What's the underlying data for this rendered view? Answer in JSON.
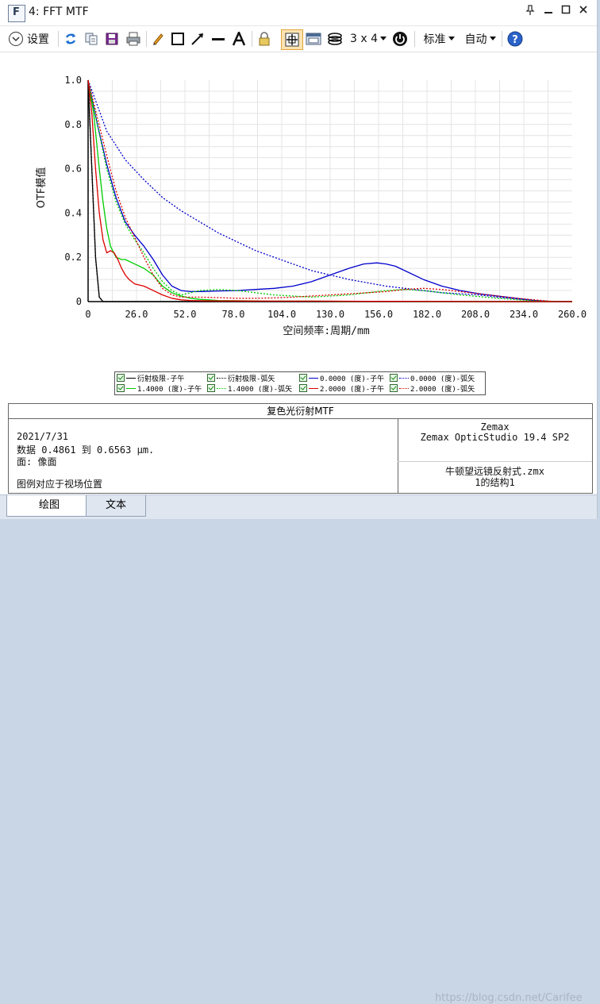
{
  "window": {
    "title": "4: FFT MTF",
    "icon_letter": "F"
  },
  "toolbar": {
    "settings_label": "设置",
    "grid_label": "3 x 4",
    "standard_label": "标准",
    "auto_label": "自动"
  },
  "chart_data": {
    "type": "line",
    "title": "",
    "xlabel": "空间频率:周期/mm",
    "ylabel": "OTF模值",
    "xlim": [
      0,
      260
    ],
    "ylim": [
      0,
      1.0
    ],
    "x_ticks": [
      "0",
      "26.0",
      "52.0",
      "78.0",
      "104.0",
      "130.0",
      "156.0",
      "182.0",
      "208.0",
      "234.0",
      "260.0"
    ],
    "y_ticks": [
      "0",
      "0.2",
      "0.4",
      "0.6",
      "0.8",
      "1.0"
    ],
    "grid": true,
    "series": [
      {
        "name": "衍射极限-子午",
        "color": "#000000",
        "dash": "solid",
        "x": [
          0,
          2,
          4,
          6,
          8,
          260
        ],
        "y": [
          1.0,
          0.6,
          0.2,
          0.02,
          0.0,
          0.0
        ]
      },
      {
        "name": "衍射极限-弧矢",
        "color": "#000000",
        "dash": "dotted",
        "x": [
          0,
          2,
          4,
          6,
          8,
          260
        ],
        "y": [
          1.0,
          0.6,
          0.2,
          0.02,
          0.0,
          0.0
        ]
      },
      {
        "name": "0.0000 (度)-子午",
        "color": "#0000cc",
        "dash": "solid",
        "x": [
          0,
          5,
          10,
          15,
          20,
          25,
          30,
          35,
          40,
          45,
          50,
          55,
          60,
          70,
          80,
          90,
          100,
          110,
          120,
          130,
          140,
          148,
          155,
          160,
          165,
          170,
          180,
          190,
          200,
          210,
          220,
          230,
          240,
          250,
          260
        ],
        "y": [
          1.0,
          0.8,
          0.62,
          0.47,
          0.36,
          0.3,
          0.25,
          0.19,
          0.12,
          0.07,
          0.05,
          0.045,
          0.045,
          0.048,
          0.05,
          0.055,
          0.06,
          0.07,
          0.09,
          0.12,
          0.15,
          0.17,
          0.175,
          0.17,
          0.16,
          0.14,
          0.1,
          0.07,
          0.05,
          0.035,
          0.025,
          0.015,
          0.005,
          0.0,
          0.0
        ]
      },
      {
        "name": "0.0000 (度)-弧矢",
        "color": "#0000cc",
        "dash": "dotted",
        "x": [
          0,
          10,
          20,
          30,
          40,
          50,
          60,
          70,
          80,
          90,
          100,
          110,
          120,
          130,
          140,
          150,
          160,
          170,
          180,
          190,
          200,
          210,
          220,
          230,
          240,
          250,
          260
        ],
        "y": [
          1.0,
          0.77,
          0.64,
          0.55,
          0.47,
          0.41,
          0.36,
          0.31,
          0.27,
          0.23,
          0.2,
          0.17,
          0.14,
          0.12,
          0.1,
          0.085,
          0.07,
          0.06,
          0.05,
          0.04,
          0.035,
          0.03,
          0.02,
          0.012,
          0.005,
          0.0,
          0.0
        ]
      },
      {
        "name": "1.4000 (度)-子午",
        "color": "#00cc00",
        "dash": "solid",
        "x": [
          0,
          3,
          6,
          8,
          10,
          12,
          15,
          18,
          20,
          25,
          30,
          35,
          40,
          45,
          50,
          55,
          60,
          70,
          80,
          90,
          100,
          110,
          120,
          140,
          160,
          180,
          200,
          220,
          240,
          260
        ],
        "y": [
          1.0,
          0.85,
          0.6,
          0.45,
          0.33,
          0.25,
          0.2,
          0.19,
          0.19,
          0.17,
          0.15,
          0.12,
          0.07,
          0.04,
          0.025,
          0.015,
          0.01,
          0.005,
          0.004,
          0.003,
          0.002,
          0.002,
          0.002,
          0.001,
          0.001,
          0.0,
          0.0,
          0.0,
          0.0,
          0.0
        ]
      },
      {
        "name": "1.4000 (度)-弧矢",
        "color": "#00cc00",
        "dash": "dotted",
        "x": [
          0,
          5,
          10,
          15,
          20,
          25,
          30,
          35,
          40,
          45,
          50,
          55,
          60,
          70,
          80,
          90,
          100,
          120,
          140,
          160,
          170,
          180,
          190,
          200,
          220,
          240,
          260
        ],
        "y": [
          1.0,
          0.8,
          0.6,
          0.45,
          0.35,
          0.28,
          0.22,
          0.15,
          0.09,
          0.05,
          0.03,
          0.04,
          0.05,
          0.055,
          0.05,
          0.04,
          0.03,
          0.02,
          0.03,
          0.05,
          0.055,
          0.05,
          0.04,
          0.03,
          0.015,
          0.003,
          0.0
        ]
      },
      {
        "name": "2.0000 (度)-子午",
        "color": "#dd0000",
        "dash": "solid",
        "x": [
          0,
          2,
          4,
          6,
          8,
          10,
          12,
          14,
          16,
          18,
          20,
          22,
          25,
          30,
          35,
          40,
          45,
          50,
          55,
          60,
          70,
          80,
          100,
          120,
          150,
          180,
          210,
          240,
          260
        ],
        "y": [
          1.0,
          0.85,
          0.6,
          0.4,
          0.28,
          0.22,
          0.23,
          0.22,
          0.19,
          0.15,
          0.12,
          0.1,
          0.08,
          0.07,
          0.05,
          0.03,
          0.015,
          0.008,
          0.005,
          0.004,
          0.003,
          0.003,
          0.002,
          0.002,
          0.001,
          0.001,
          0.0,
          0.0,
          0.0
        ]
      },
      {
        "name": "2.0000 (度)-弧矢",
        "color": "#dd0000",
        "dash": "dotted",
        "x": [
          0,
          5,
          10,
          15,
          20,
          25,
          30,
          35,
          40,
          45,
          50,
          55,
          60,
          70,
          80,
          90,
          100,
          110,
          120,
          130,
          140,
          150,
          160,
          170,
          180,
          190,
          200,
          210,
          220,
          230,
          240,
          250,
          260
        ],
        "y": [
          1.0,
          0.83,
          0.66,
          0.5,
          0.38,
          0.29,
          0.2,
          0.12,
          0.06,
          0.03,
          0.02,
          0.02,
          0.02,
          0.018,
          0.015,
          0.015,
          0.017,
          0.02,
          0.025,
          0.03,
          0.035,
          0.04,
          0.045,
          0.055,
          0.06,
          0.055,
          0.045,
          0.035,
          0.025,
          0.015,
          0.008,
          0.0,
          0.0
        ]
      }
    ]
  },
  "legend": {
    "items": [
      "衍射极限-子午",
      "衍射极限-弧矢",
      "0.0000 (度)-子午",
      "0.0000 (度)-弧矢",
      "1.4000 (度)-子午",
      "1.4000 (度)-弧矢",
      "2.0000 (度)-子午",
      "2.0000 (度)-弧矢"
    ]
  },
  "info": {
    "title": "复色光衍射MTF",
    "date": "2021/7/31",
    "data_range": "数据 0.4861 到 0.6563 μm.",
    "surface": "面: 像面",
    "legend_note": "图例对应于视场位置",
    "company": "Zemax",
    "product": "Zemax OpticStudio 19.4 SP2",
    "file": "牛顿望远镜反射式.zmx",
    "config": "1的结构1"
  },
  "tabs": {
    "graph": "绘图",
    "text": "文本"
  },
  "watermark": "https://blog.csdn.net/Carifee"
}
